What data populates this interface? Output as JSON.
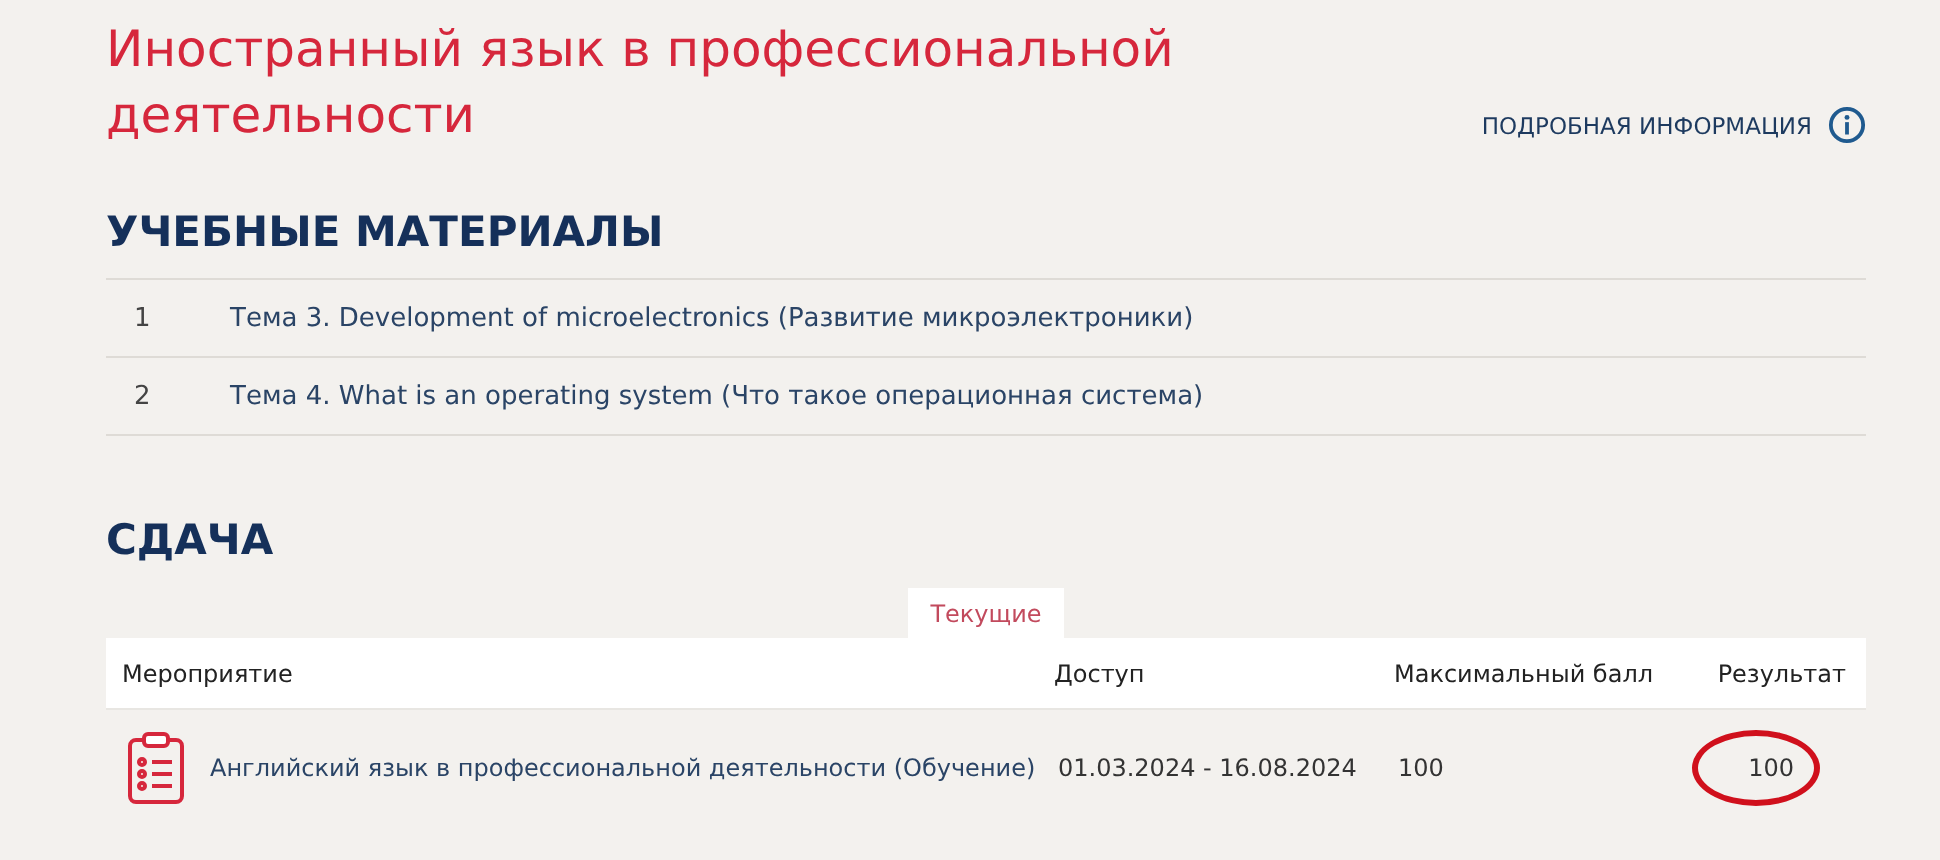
{
  "title": "Иностранный язык в профессиональной деятельности",
  "info_link": "ПОДРОБНАЯ ИНФОРМАЦИЯ",
  "materials": {
    "heading": "УЧЕБНЫЕ МАТЕРИАЛЫ",
    "items": [
      {
        "number": "1",
        "title": "Тема 3. Development of microelectronics (Развитие микроэлектроники)"
      },
      {
        "number": "2",
        "title": "Тема 4. What is an operating system (Что такое операционная система)"
      }
    ]
  },
  "submission": {
    "heading": "СДАЧА",
    "tabs": [
      {
        "label": "Текущие",
        "selected": true
      }
    ],
    "table": {
      "columns": [
        "Мероприятие",
        "Доступ",
        "Максимальный балл",
        "Результат"
      ],
      "rows": [
        {
          "event": "Английский язык в профессиональной деятельности (Обучение)",
          "access": "01.03.2024 - 16.08.2024",
          "max_score": "100",
          "result": "100",
          "result_circled": true
        }
      ]
    }
  }
}
